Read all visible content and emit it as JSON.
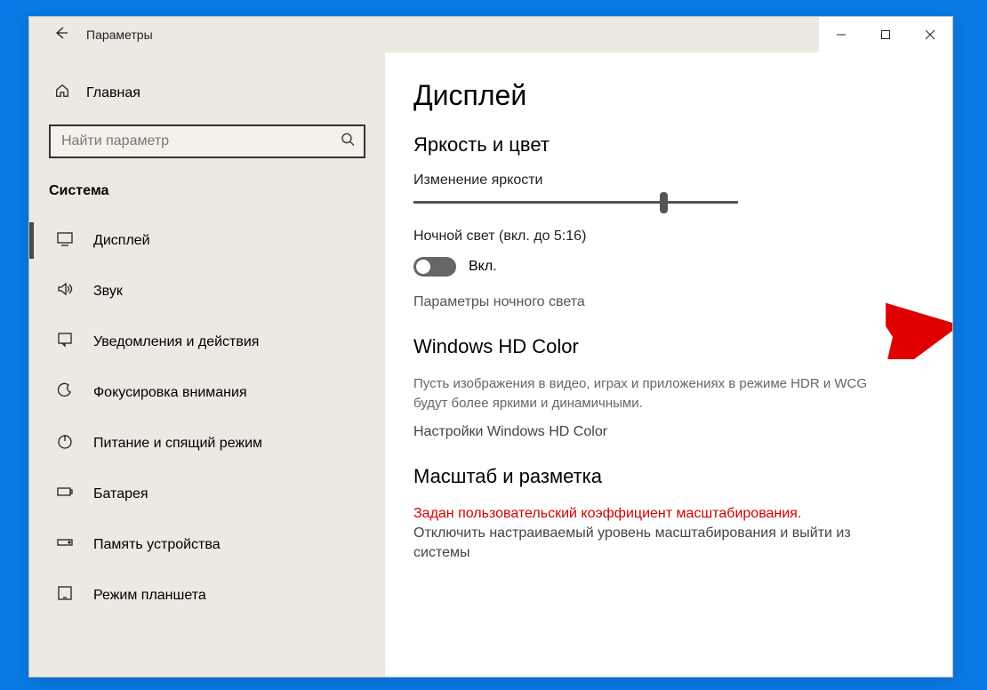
{
  "titlebar": {
    "title": "Параметры"
  },
  "sidebar": {
    "home": "Главная",
    "search_placeholder": "Найти параметр",
    "section": "Система",
    "items": [
      {
        "label": "Дисплей"
      },
      {
        "label": "Звук"
      },
      {
        "label": "Уведомления и действия"
      },
      {
        "label": "Фокусировка внимания"
      },
      {
        "label": "Питание и спящий режим"
      },
      {
        "label": "Батарея"
      },
      {
        "label": "Память устройства"
      },
      {
        "label": "Режим планшета"
      }
    ]
  },
  "main": {
    "heading": "Дисплей",
    "brightness_section": "Яркость и цвет",
    "brightness_label": "Изменение яркости",
    "nightlight_label": "Ночной свет (вкл. до 5:16)",
    "toggle_state": "Вкл.",
    "nightlight_settings": "Параметры ночного света",
    "hdr_heading": "Windows HD Color",
    "hdr_desc": "Пусть изображения в видео, играх и приложениях в режиме HDR и WCG будут более яркими и динамичными.",
    "hdr_link": "Настройки Windows HD Color",
    "scale_heading": "Масштаб и разметка",
    "scale_warning": "Задан пользовательский коэффициент масштабирования.",
    "scale_action": "Отключить настраиваемый уровень масштабирования и выйти из системы"
  }
}
